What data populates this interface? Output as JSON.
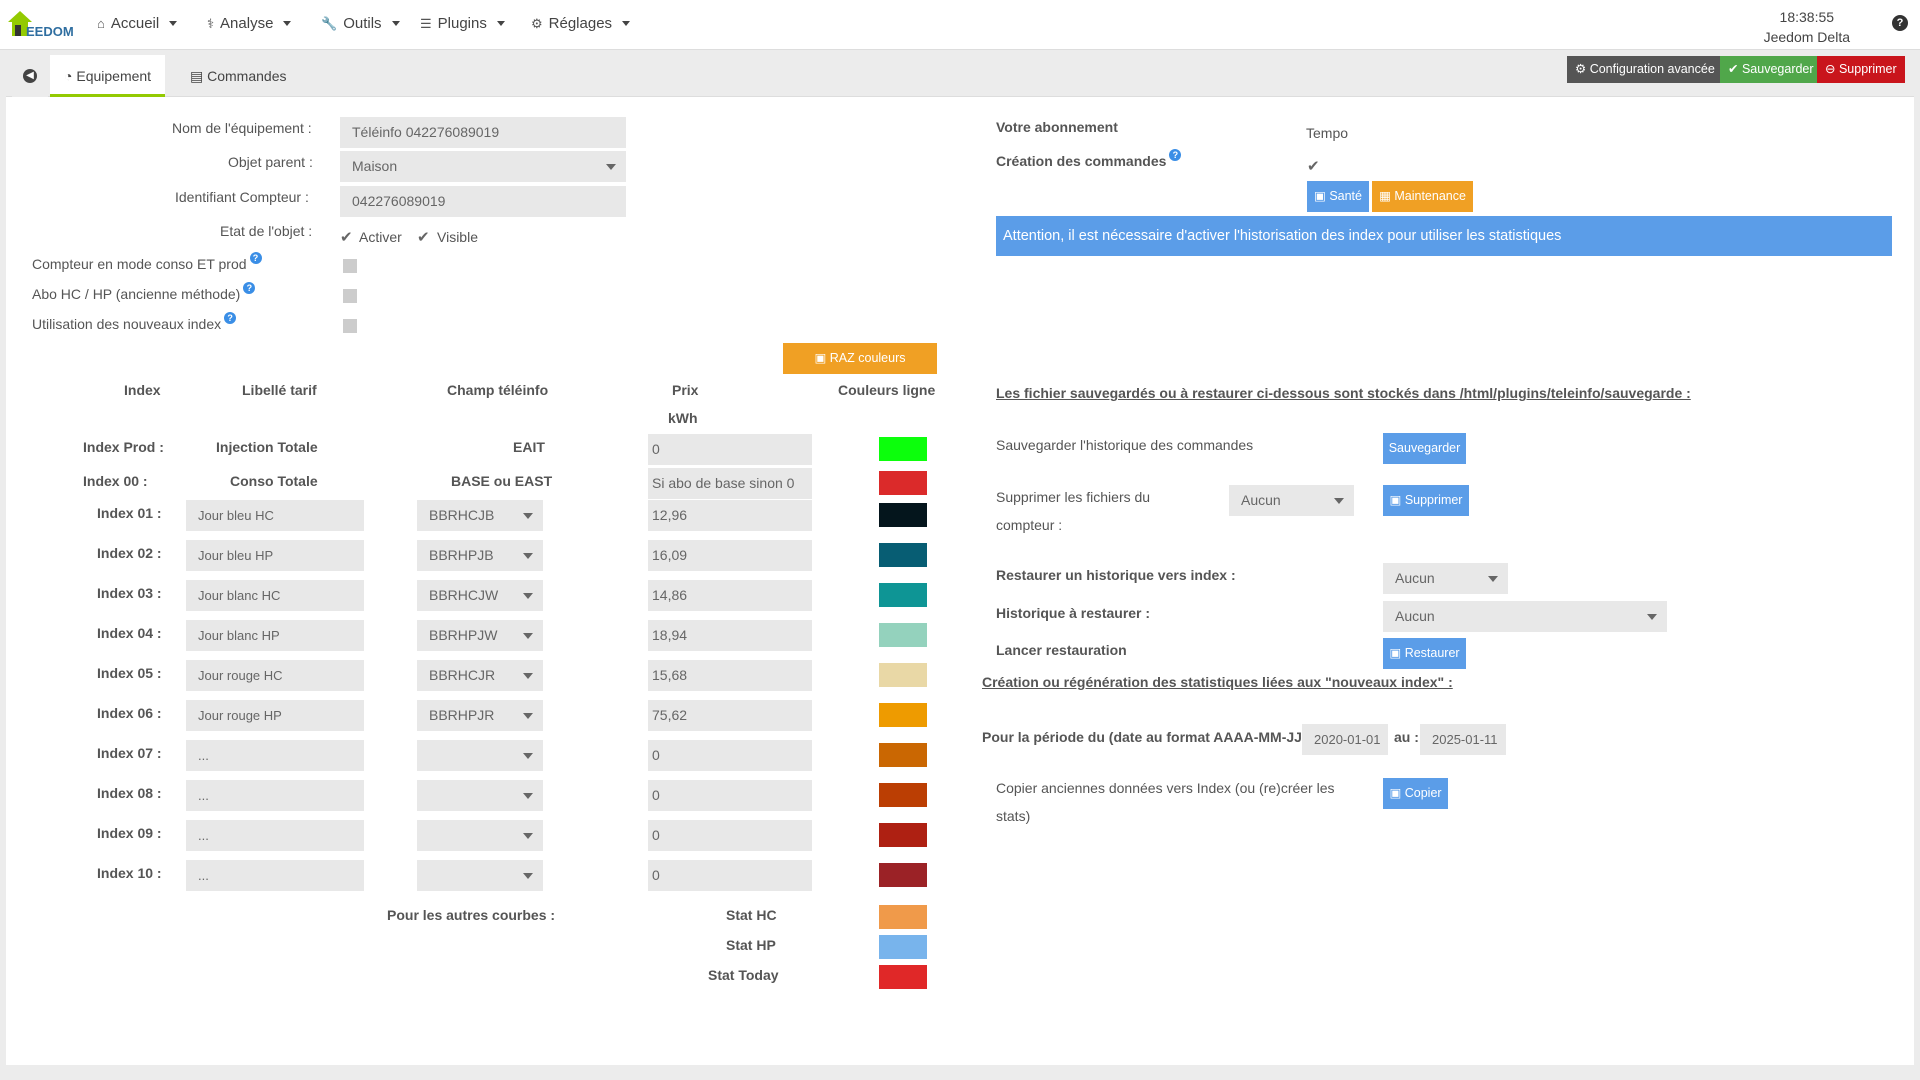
{
  "nav": {
    "logo_text": "EEDOM",
    "menus": [
      {
        "label": "Accueil",
        "icon": "home-icon"
      },
      {
        "label": "Analyse",
        "icon": "stethoscope-icon"
      },
      {
        "label": "Outils",
        "icon": "wrench-icon"
      },
      {
        "label": "Plugins",
        "icon": "tasks-icon"
      },
      {
        "label": "Réglages",
        "icon": "cogs-icon"
      }
    ],
    "time": "18:38:55",
    "user": "Jeedom Delta",
    "help": "?"
  },
  "tabs": [
    {
      "label": "Equipement",
      "icon": "tachometer-icon"
    },
    {
      "label": "Commandes",
      "icon": "list-icon"
    }
  ],
  "actions": {
    "advanced": "Configuration avancée",
    "save": "Sauvegarder",
    "delete": "Supprimer"
  },
  "colors": {
    "accent": "#93ca02",
    "blue": "#5b9de8",
    "orange": "#f0a024",
    "red": "#c9151c",
    "green": "#50a74a",
    "dark": "#555555"
  },
  "form": {
    "name_label": "Nom de l'équipement :",
    "name_value": "Téléinfo 042276089019",
    "parent_label": "Objet parent :",
    "parent_value": "Maison",
    "meter_label": "Identifiant Compteur :",
    "meter_value": "042276089019",
    "state_label": "Etat de l'objet :",
    "activate": "Activer",
    "visible": "Visible",
    "conso_prod": "Compteur en mode conso ET prod",
    "hchp": "Abo HC / HP (ancienne méthode)",
    "new_index": "Utilisation des nouveaux index"
  },
  "table": {
    "raz": "RAZ couleurs",
    "headers": {
      "index": "Index",
      "tarif": "Libellé tarif",
      "champ": "Champ téléinfo",
      "prix": "Prix",
      "unit": "kWh",
      "couleurs": "Couleurs ligne"
    },
    "fixed_rows": [
      {
        "index": "Index Prod :",
        "tarif": "Injection Totale",
        "champ": "EAIT",
        "prix": "0",
        "color": "#0cff0c"
      },
      {
        "index": "Index 00 :",
        "tarif": "Conso Totale",
        "champ": "BASE ou EAST",
        "prix": "Si abo de base sinon 0",
        "color": "#db2a2a"
      }
    ],
    "rows": [
      {
        "index": "Index 01 :",
        "tarif": "Jour bleu HC",
        "champ": "BBRHCJB",
        "prix": "12,96",
        "color": "#04151c"
      },
      {
        "index": "Index 02 :",
        "tarif": "Jour bleu HP",
        "champ": "BBRHPJB",
        "prix": "16,09",
        "color": "#075d73"
      },
      {
        "index": "Index 03 :",
        "tarif": "Jour blanc HC",
        "champ": "BBRHCJW",
        "prix": "14,86",
        "color": "#0e9595"
      },
      {
        "index": "Index 04 :",
        "tarif": "Jour blanc HP",
        "champ": "BBRHPJW",
        "prix": "18,94",
        "color": "#94d2bd"
      },
      {
        "index": "Index 05 :",
        "tarif": "Jour rouge HC",
        "champ": "BBRHCJR",
        "prix": "15,68",
        "color": "#e9d8a6"
      },
      {
        "index": "Index 06 :",
        "tarif": "Jour rouge HP",
        "champ": "BBRHPJR",
        "prix": "75,62",
        "color": "#ee9b00"
      },
      {
        "index": "Index 07 :",
        "tarif": "...",
        "champ": "",
        "prix": "0",
        "color": "#ca6702"
      },
      {
        "index": "Index 08 :",
        "tarif": "...",
        "champ": "",
        "prix": "0",
        "color": "#bb3e03"
      },
      {
        "index": "Index 09 :",
        "tarif": "...",
        "champ": "",
        "prix": "0",
        "color": "#ae2012"
      },
      {
        "index": "Index 10 :",
        "tarif": "...",
        "champ": "",
        "prix": "0",
        "color": "#9b2226"
      }
    ],
    "other_curves": "Pour les autres courbes :",
    "stats": [
      {
        "label": "Stat HC",
        "color": "#f09a4a"
      },
      {
        "label": "Stat HP",
        "color": "#78b4ec"
      },
      {
        "label": "Stat Today",
        "color": "#e02828"
      }
    ]
  },
  "right": {
    "subscription_label": "Votre abonnement",
    "subscription_value": "Tempo",
    "cmd_creation": "Création des commandes",
    "health": "Santé",
    "maintenance": "Maintenance",
    "alert": "Attention, il est nécessaire d'activer l'historisation des index pour utiliser les statistiques",
    "backup_note": "Les fichier sauvegardés ou à restaurer ci-dessous sont stockés dans /html/plugins/teleinfo/sauvegarde :",
    "save_history": "Sauvegarder l'historique des commandes",
    "save_btn": "Sauvegarder",
    "delete_files_1": "Supprimer les fichiers du",
    "delete_files_2": "compteur :",
    "delete_select": "Aucun",
    "delete_btn": "Supprimer",
    "restore_index": "Restaurer un historique vers index :",
    "restore_index_select": "Aucun",
    "history_restore": "Historique à restaurer :",
    "history_select": "Aucun",
    "launch_restore": "Lancer restauration",
    "restore_btn": "Restaurer",
    "stats_title": "Création ou régénération des statistiques liées aux \"nouveaux index\" :",
    "period_label": "Pour la période du (date au format AAAA-MM-JJ) :",
    "date_from": "2020-01-01",
    "to": "au :",
    "date_to": "2025-01-11",
    "copy_1": "Copier anciennes données vers Index (ou (re)créer les",
    "copy_2": "stats)",
    "copy_btn": "Copier"
  }
}
